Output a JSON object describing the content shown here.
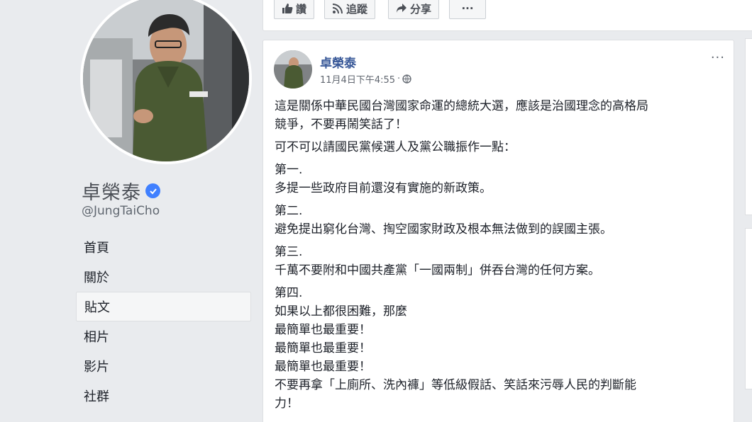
{
  "actions": [
    {
      "name": "like-button",
      "icon": "thumbs-up-icon",
      "label": "讚"
    },
    {
      "name": "follow-button",
      "icon": "rss-icon",
      "label": "追蹤"
    },
    {
      "name": "share-button",
      "icon": "share-arrow-icon",
      "label": "分享"
    },
    {
      "name": "more-button",
      "icon": "ellipsis-icon",
      "label": "···"
    }
  ],
  "profile": {
    "name": "卓榮泰",
    "handle": "@JungTaiCho",
    "verified": true
  },
  "nav": [
    {
      "label": "首頁"
    },
    {
      "label": "關於"
    },
    {
      "label": "貼文",
      "active": true
    },
    {
      "label": "相片"
    },
    {
      "label": "影片"
    },
    {
      "label": "社群"
    }
  ],
  "post": {
    "author": "卓榮泰",
    "timestamp": "11月4日下午4:55",
    "separator": "·",
    "menu": "···",
    "paragraphs": [
      [
        "這是關係中華民國台灣國家命運的總統大選，應該是治國理念的高格局",
        "競爭，不要再鬧笑話了！"
      ],
      [
        "可不可以請國民黨候選人及黨公職振作一點："
      ],
      [
        "第一.",
        "多提一些政府目前還沒有實施的新政策。"
      ],
      [
        "第二.",
        "避免提出窮化台灣、掏空國家財政及根本無法做到的誤國主張。"
      ],
      [
        "第三.",
        "千萬不要附和中國共產黨「一國兩制」併吞台灣的任何方案。"
      ],
      [
        "第四.",
        "如果以上都很困難，那麼",
        "最簡單也最重要！",
        "最簡單也最重要！",
        "最簡單也最重要！",
        "不要再拿「上廁所、洗內褲」等低級假話、笑話來污辱人民的判斷能",
        "力！"
      ]
    ]
  }
}
